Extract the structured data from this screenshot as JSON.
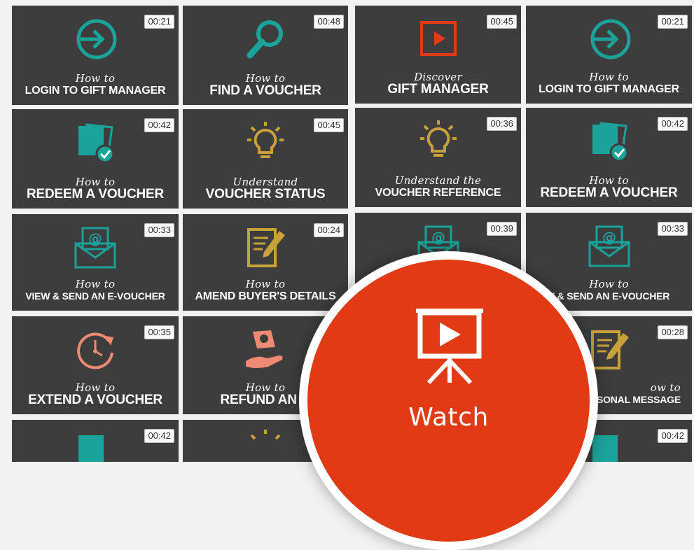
{
  "colors": {
    "tile_bg": "#3d3d3d",
    "teal": "#1aa39a",
    "gold": "#c9a13a",
    "red": "#e13a14",
    "salmon": "#ee8a73"
  },
  "tiles": [
    {
      "icon": "login-icon",
      "duration": "00:21",
      "pre": "How to",
      "title": "LOGIN TO GIFT MANAGER"
    },
    {
      "icon": "search-icon",
      "duration": "00:48",
      "pre": "How to",
      "title": "FIND A VOUCHER"
    },
    {
      "icon": "play-icon",
      "duration": "00:45",
      "pre": "Discover",
      "title": "GIFT MANAGER"
    },
    {
      "icon": "login-icon",
      "duration": "00:21",
      "pre": "How to",
      "title": "LOGIN TO GIFT MANAGER"
    },
    {
      "icon": "voucher-check-icon",
      "duration": "00:42",
      "pre": "How to",
      "title": "REDEEM A VOUCHER"
    },
    {
      "icon": "lightbulb-icon",
      "duration": "00:45",
      "pre": "Understand",
      "title": "VOUCHER STATUS"
    },
    {
      "icon": "lightbulb-icon",
      "duration": "00:36",
      "pre": "Understand the",
      "title": "VOUCHER REFERENCE"
    },
    {
      "icon": "voucher-check-icon",
      "duration": "00:42",
      "pre": "How to",
      "title": "REDEEM A VOUCHER"
    },
    {
      "icon": "email-icon",
      "duration": "00:33",
      "pre": "How to",
      "title": "VIEW & SEND AN E-VOUCHER"
    },
    {
      "icon": "document-edit-icon",
      "duration": "00:24",
      "pre": "How to",
      "title": "AMEND BUYER'S DETAILS"
    },
    {
      "icon": "email-icon",
      "duration": "00:39",
      "pre": "",
      "title": ""
    },
    {
      "icon": "email-icon",
      "duration": "00:33",
      "pre": "How to",
      "title": "V & SEND AN E-VOUCHER"
    },
    {
      "icon": "clock-icon",
      "duration": "00:35",
      "pre": "How to",
      "title": "EXTEND A VOUCHER"
    },
    {
      "icon": "refund-icon",
      "duration": "",
      "pre": "How to",
      "title": "REFUND AN O"
    },
    {
      "icon": "",
      "duration": "",
      "pre": "",
      "title": ""
    },
    {
      "icon": "document-edit-icon",
      "duration": "00:28",
      "pre": "ow to",
      "title": "ERSONAL MESSAGE"
    },
    {
      "icon": "voucher-check-icon",
      "duration": "00:42",
      "pre": "",
      "title": ""
    },
    {
      "icon": "lightbulb-icon",
      "duration": "",
      "pre": "",
      "title": ""
    },
    {
      "icon": "",
      "duration": "",
      "pre": "",
      "title": ""
    },
    {
      "icon": "voucher-check-icon",
      "duration": "00:42",
      "pre": "",
      "title": ""
    }
  ],
  "overlay": {
    "label": "Watch",
    "icon": "presentation-play-icon"
  }
}
